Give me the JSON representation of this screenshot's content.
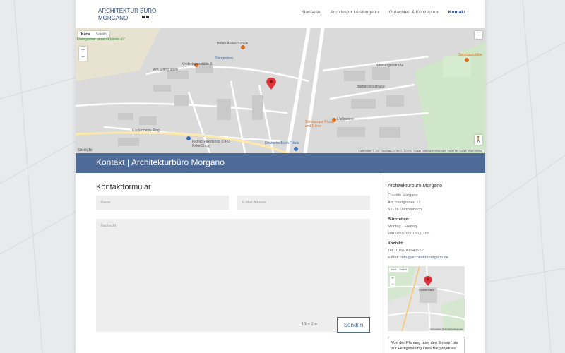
{
  "header": {
    "logo_line1": "ARCHITEKTUR BÜRO",
    "logo_line2": "MORGANO",
    "nav": [
      {
        "label": "Startseite",
        "dropdown": false,
        "active": false
      },
      {
        "label": "Architektur Leistungen",
        "dropdown": true,
        "active": false
      },
      {
        "label": "Gutachten & Konzepte",
        "dropdown": true,
        "active": false
      },
      {
        "label": "Kontakt",
        "dropdown": false,
        "active": true
      }
    ]
  },
  "map": {
    "tabs": [
      "Karte",
      "Satellit"
    ],
    "zoom_in": "+",
    "zoom_out": "−",
    "fullscreen_icon": "⛶",
    "pegman_icon": "🚶",
    "labels": {
      "school": "Helen-Keller-Schule",
      "street1": "Stiergraben",
      "kita": "Kindertagesstätte XI",
      "street2": "Am Stiergraben",
      "steinberger": "Steinberger Pizza und Döner",
      "alligatore": "L'alligatore",
      "pickup": "Pickup Paketshop (DPD PaketShop)",
      "deutsche_bank": "Deutsche Bank Filiale",
      "sport": "Sportgaststätte",
      "kleingarten": "Kleingärtner verein Kolonie eV",
      "street3": "Kindermann-Ring",
      "street4": "Nibelungenstraße",
      "street5": "Barbarossastraße"
    },
    "google": "Google",
    "footer": "Kartendaten © 2017 GeoBasis-DE/BKG (©2009), Google   Nutzungsbedingungen   Fehler bei Google Maps melden"
  },
  "band": {
    "title": "Kontakt | Architekturbüro Morgano"
  },
  "form": {
    "title": "Kontaktformular",
    "name_placeholder": "Name",
    "email_placeholder": "E-Mail-Adresse",
    "message_placeholder": "Nachricht",
    "captcha": "13 + 2 =",
    "send_label": "Senden"
  },
  "sidebar": {
    "heading": "Architekturbüro Morgano",
    "person": "Claudio Morgano",
    "street": "Am Stiergraben 12",
    "city": "63128 Dietzenbach",
    "hours_label": "Bürozeiten:",
    "hours_days": "Montag - Freitag",
    "hours_time": "von 08:00 bis 16:00 Uhr",
    "contact_label": "Kontakt:",
    "tel": "Tel.: 0151 41943152",
    "mail_prefix": "e-Mail: ",
    "mail": "info@architekt-morgano.de",
    "mini_map": {
      "tabs": [
        "Karte",
        "Satellit"
      ],
      "city_label": "Dietzenbach",
      "footer": "Kartendaten   Nutzungsbedingungen"
    },
    "promo": "Von der Planung über den Entwurf bis zur Fertigstellung Ihres Bauprojektes"
  },
  "colors": {
    "accent": "#4e6a96",
    "nav_active": "#2f4a7d",
    "marker": "#e0303a"
  }
}
